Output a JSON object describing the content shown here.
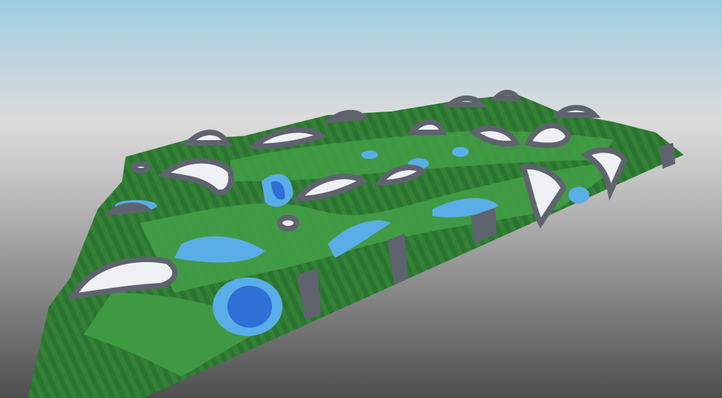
{
  "scene": {
    "kind": "voxel-terrain-render",
    "colors": {
      "sky_top": "#9fcde0",
      "sky_horizon": "#dcdcdc",
      "ground_far": "#c9c9c9",
      "ground_near": "#4e4e4e",
      "grass_dark": "#2f7d33",
      "grass_light": "#45a048",
      "rock": "#5f636e",
      "snow": "#eef0f4",
      "water_shallow": "#5aaee8",
      "water_deep": "#2f6fd6"
    }
  }
}
